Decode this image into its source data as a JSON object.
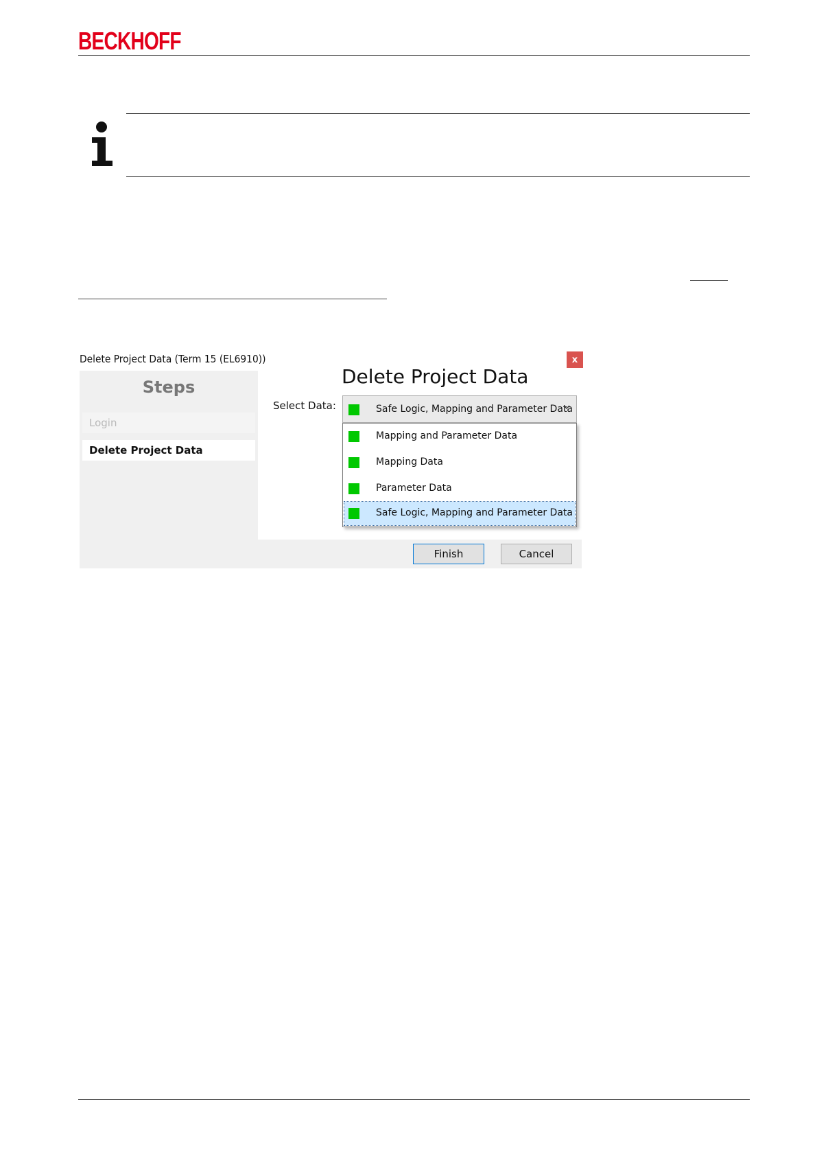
{
  "header": {
    "logo_text": "BECKHOFF",
    "brand_color": "#e2001a"
  },
  "note": {
    "icon": "info-icon"
  },
  "dialog": {
    "window_title": "Delete Project Data (Term 15 (EL6910))",
    "close_label": "x",
    "steps": {
      "heading": "Steps",
      "items": [
        {
          "label": "Login",
          "state": "disabled"
        },
        {
          "label": "Delete Project Data",
          "state": "active"
        }
      ]
    },
    "heading": "Delete Project Data",
    "select_label": "Select Data:",
    "combo": {
      "selected": "Safe Logic, Mapping and Parameter Data",
      "indicator_color": "#00c800",
      "options": [
        {
          "label": "Mapping and Parameter Data"
        },
        {
          "label": "Mapping Data"
        },
        {
          "label": "Parameter Data"
        },
        {
          "label": "Safe Logic, Mapping and Parameter Data",
          "selected": true
        }
      ]
    },
    "buttons": {
      "finish": "Finish",
      "cancel": "Cancel"
    }
  }
}
